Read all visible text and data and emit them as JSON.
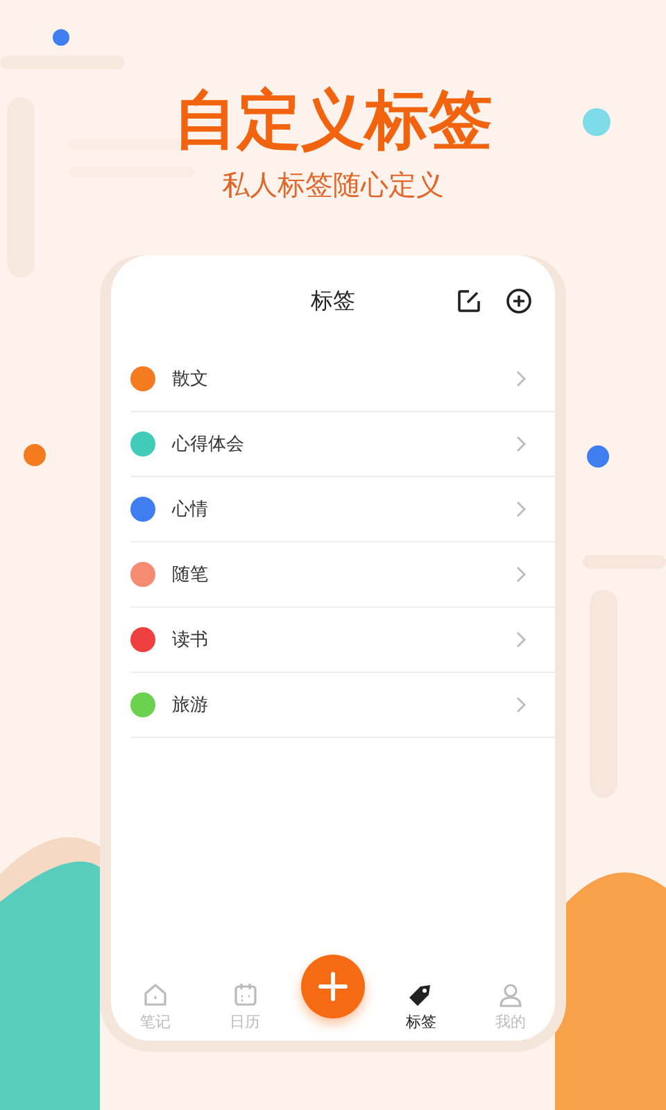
{
  "headline": "自定义标签",
  "subtitle": "私人标签随心定义",
  "screen": {
    "title": "标签",
    "tags": [
      {
        "name": "散文",
        "color": "#f47b20"
      },
      {
        "name": "心得体会",
        "color": "#3ecbb8"
      },
      {
        "name": "心情",
        "color": "#3f7ef0"
      },
      {
        "name": "随笔",
        "color": "#f58c72"
      },
      {
        "name": "读书",
        "color": "#ef4040"
      },
      {
        "name": "旅游",
        "color": "#6ad24e"
      }
    ],
    "tab_bar": [
      {
        "label": "笔记",
        "selected": false
      },
      {
        "label": "日历",
        "selected": false
      },
      {
        "label": "标签",
        "selected": true
      },
      {
        "label": "我的",
        "selected": false
      }
    ]
  }
}
